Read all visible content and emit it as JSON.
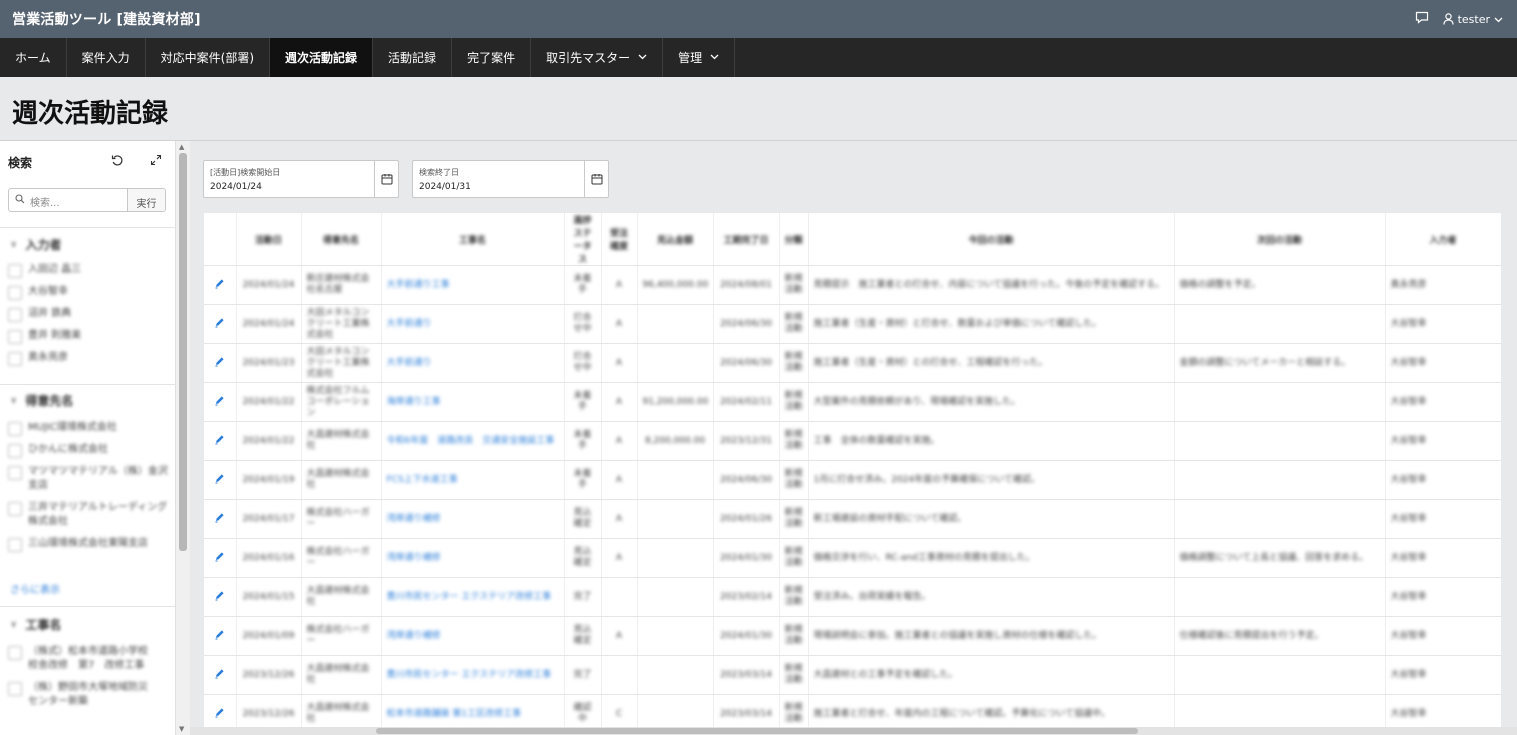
{
  "app": {
    "title": "営業活動ツール [建設資材部]",
    "user": "tester"
  },
  "nav": [
    {
      "label": "ホーム",
      "active": false,
      "dropdown": false
    },
    {
      "label": "案件入力",
      "active": false,
      "dropdown": false
    },
    {
      "label": "対応中案件(部署)",
      "active": false,
      "dropdown": false
    },
    {
      "label": "週次活動記録",
      "active": true,
      "dropdown": false
    },
    {
      "label": "活動記録",
      "active": false,
      "dropdown": false
    },
    {
      "label": "完了案件",
      "active": false,
      "dropdown": false
    },
    {
      "label": "取引先マスター",
      "active": false,
      "dropdown": true
    },
    {
      "label": "管理",
      "active": false,
      "dropdown": true
    }
  ],
  "page": {
    "title": "週次活動記録"
  },
  "search": {
    "label": "検索",
    "placeholder": "検索...",
    "go_label": "実行"
  },
  "facets": {
    "f1": {
      "title": "入力者",
      "options": [
        "入田辺 晶三",
        "大谷智幸",
        "沼井 鉄典",
        "豊井 則雅楽",
        "奥永亮彦"
      ]
    },
    "f2": {
      "title": "得意先名",
      "options": [
        "MUJIC環境株式会社",
        "ひかんに株式会社",
        "マツマツマテリアル（株）金沢支店",
        "三井マテリアルトレーディング株式会社",
        "三山環境株式会社東陽支店"
      ],
      "show_more": "さらに表示"
    },
    "f3": {
      "title": "工事名",
      "options": [
        "（株式）松本市道路小学校校舎改修　第7　改修工事",
        "（株）野田市大塚地域防災センター新築"
      ]
    }
  },
  "filters": {
    "start": {
      "label": "[活動日]検索開始日",
      "value": "2024/01/24"
    },
    "end": {
      "label": "検索終了日",
      "value": "2024/01/31"
    }
  },
  "table": {
    "columns": [
      "",
      "活動日",
      "得意先名",
      "工事名",
      "進捗ステータス",
      "受注確度",
      "見込金額",
      "工期完了日",
      "分類",
      "今回の活動",
      "次回の活動",
      "入力者"
    ],
    "rows": [
      [
        "",
        "2024/01/24",
        "新庄建材株式会社名古屋",
        "大手前通り工事",
        "未着手",
        "A",
        "96,400,000.00",
        "2024/08/01",
        "新規活動",
        "見積提示　施工業者との打合せ、内容について協議を行った。今後の予定を確認する。",
        "価格の調整を予定。",
        "奥永亮彦"
      ],
      [
        "",
        "2024/01/24",
        "大田メタルコンクリート工業株式会社",
        "大手前通り",
        "打合せ中",
        "A",
        "",
        "2024/06/30",
        "新規活動",
        "施工業者（生産・資材）と打合せ、数量および単価について確認した。",
        "",
        "大谷智幸"
      ],
      [
        "",
        "2024/01/23",
        "大田メタルコンクリート工業株式会社",
        "大手前通り",
        "打合せ中",
        "A",
        "",
        "2024/06/30",
        "新規活動",
        "施工業者（生産・資材）との打合せ、工程確認を行った。",
        "金額の調整についてメーカーと相談する。",
        "大谷智幸"
      ],
      [
        "",
        "2024/01/22",
        "株式会社フルムコーポレーション",
        "海岸通り工事",
        "未着手",
        "A",
        "91,200,000.00",
        "2024/02/11",
        "新規活動",
        "大型案件の見積依頼があり、現場確認を実施した。",
        "",
        "大谷智幸"
      ],
      [
        "",
        "2024/01/22",
        "大昌建材株式会社",
        "令和6年度　道路改良　交通安全施設工事",
        "未着手",
        "A",
        "8,200,000.00",
        "2023/12/31",
        "新規活動",
        "工事　全体の数量確認を実施。",
        "",
        "大谷智幸"
      ],
      [
        "",
        "2024/01/19",
        "大昌建材株式会社",
        "FCS上下水道工事",
        "未着手",
        "A",
        "",
        "2024/06/30",
        "新規活動",
        "1月に打合せ済み。2024年度の予算確保について確認。",
        "",
        "大谷智幸"
      ],
      [
        "",
        "2024/01/17",
        "株式会社ハーガー",
        "湾岸通り補修",
        "見込確定",
        "A",
        "",
        "2024/01/26",
        "新規活動",
        "新工場建設の資材手配について確認。",
        "",
        "大谷智幸"
      ],
      [
        "",
        "2024/01/16",
        "株式会社ハーガー",
        "湾岸通り補修",
        "見込確定",
        "A",
        "",
        "2024/01/30",
        "新規活動",
        "価格交渉を行い、RC-and工事資材の見積を提出した。",
        "価格調整について上長と協議、回答を求める。",
        "大谷智幸"
      ],
      [
        "",
        "2024/01/15",
        "大昌建材株式会社",
        "豊川市民センター エクステリア改修工事",
        "完了",
        "",
        "",
        "2023/02/14",
        "新規活動",
        "受注済み。出荷実績を報告。",
        "",
        "大谷智幸"
      ],
      [
        "",
        "2024/01/09",
        "株式会社ハーガー",
        "湾岸通り補修",
        "見込確定",
        "A",
        "",
        "2024/01/30",
        "新規活動",
        "現場説明会に参加。施工業者との協議を実施し資材の仕様を確認した。",
        "仕様確認後に見積提出を行う予定。",
        "大谷智幸"
      ],
      [
        "",
        "2023/12/26",
        "大昌建材株式会社",
        "豊川市民センター エクステリア改修工事",
        "完了",
        "",
        "",
        "2023/03/14",
        "新規活動",
        "大昌建材との工事予定を確認した。",
        "",
        "大谷智幸"
      ],
      [
        "",
        "2023/12/26",
        "大昌建材株式会社",
        "松本市道路舗装 第1工区改修工事",
        "確認中",
        "C",
        "",
        "2023/03/14",
        "新規活動",
        "施工業者と打合せ、年度内の工程について確認。予算化について協議中。",
        "",
        "大谷智幸"
      ]
    ]
  },
  "colors": {
    "header_bg": "#556270",
    "nav_bg": "#262626",
    "nav_active_bg": "#111111",
    "link": "#2a7dd8"
  }
}
